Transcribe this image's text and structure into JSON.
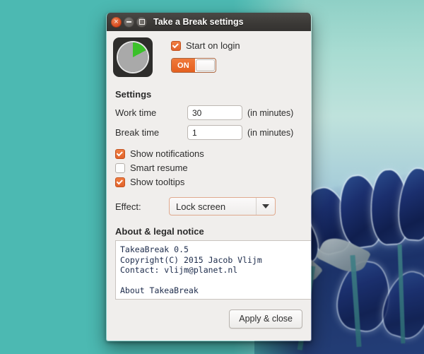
{
  "window": {
    "title": "Take a Break settings",
    "buttons": {
      "close": "close-button",
      "minimize": "minimize-button",
      "maximize": "maximize-button"
    }
  },
  "top": {
    "app_icon": "takeabreak-pie-icon",
    "start_on_login_label": "Start on login",
    "start_on_login_checked": true,
    "toggle_label": "ON",
    "toggle_state": "on"
  },
  "settings": {
    "heading": "Settings",
    "fields": [
      {
        "label": "Work time",
        "value": "30",
        "suffix": "(in minutes)"
      },
      {
        "label": "Break time",
        "value": "1",
        "suffix": "(in minutes)"
      }
    ],
    "checkboxes": [
      {
        "label": "Show notifications",
        "checked": true
      },
      {
        "label": "Smart resume",
        "checked": false
      },
      {
        "label": "Show tooltips",
        "checked": true
      }
    ],
    "effect": {
      "label": "Effect:",
      "selected": "Lock screen",
      "options": [
        "Lock screen"
      ]
    }
  },
  "about": {
    "heading": "About & legal notice",
    "text": "TakeaBreak 0.5\nCopyright(C) 2015 Jacob Vlijm\nContact: vlijm@planet.nl\n\nAbout TakeaBreak\n----------------"
  },
  "footer": {
    "apply_label": "Apply & close"
  },
  "colors": {
    "accent_orange": "#e4601f",
    "titlebar": "#3c3a37",
    "window_bg": "#f0eeec",
    "icon_green": "#3bc12a",
    "desktop_teal": "#4cb9b2"
  }
}
